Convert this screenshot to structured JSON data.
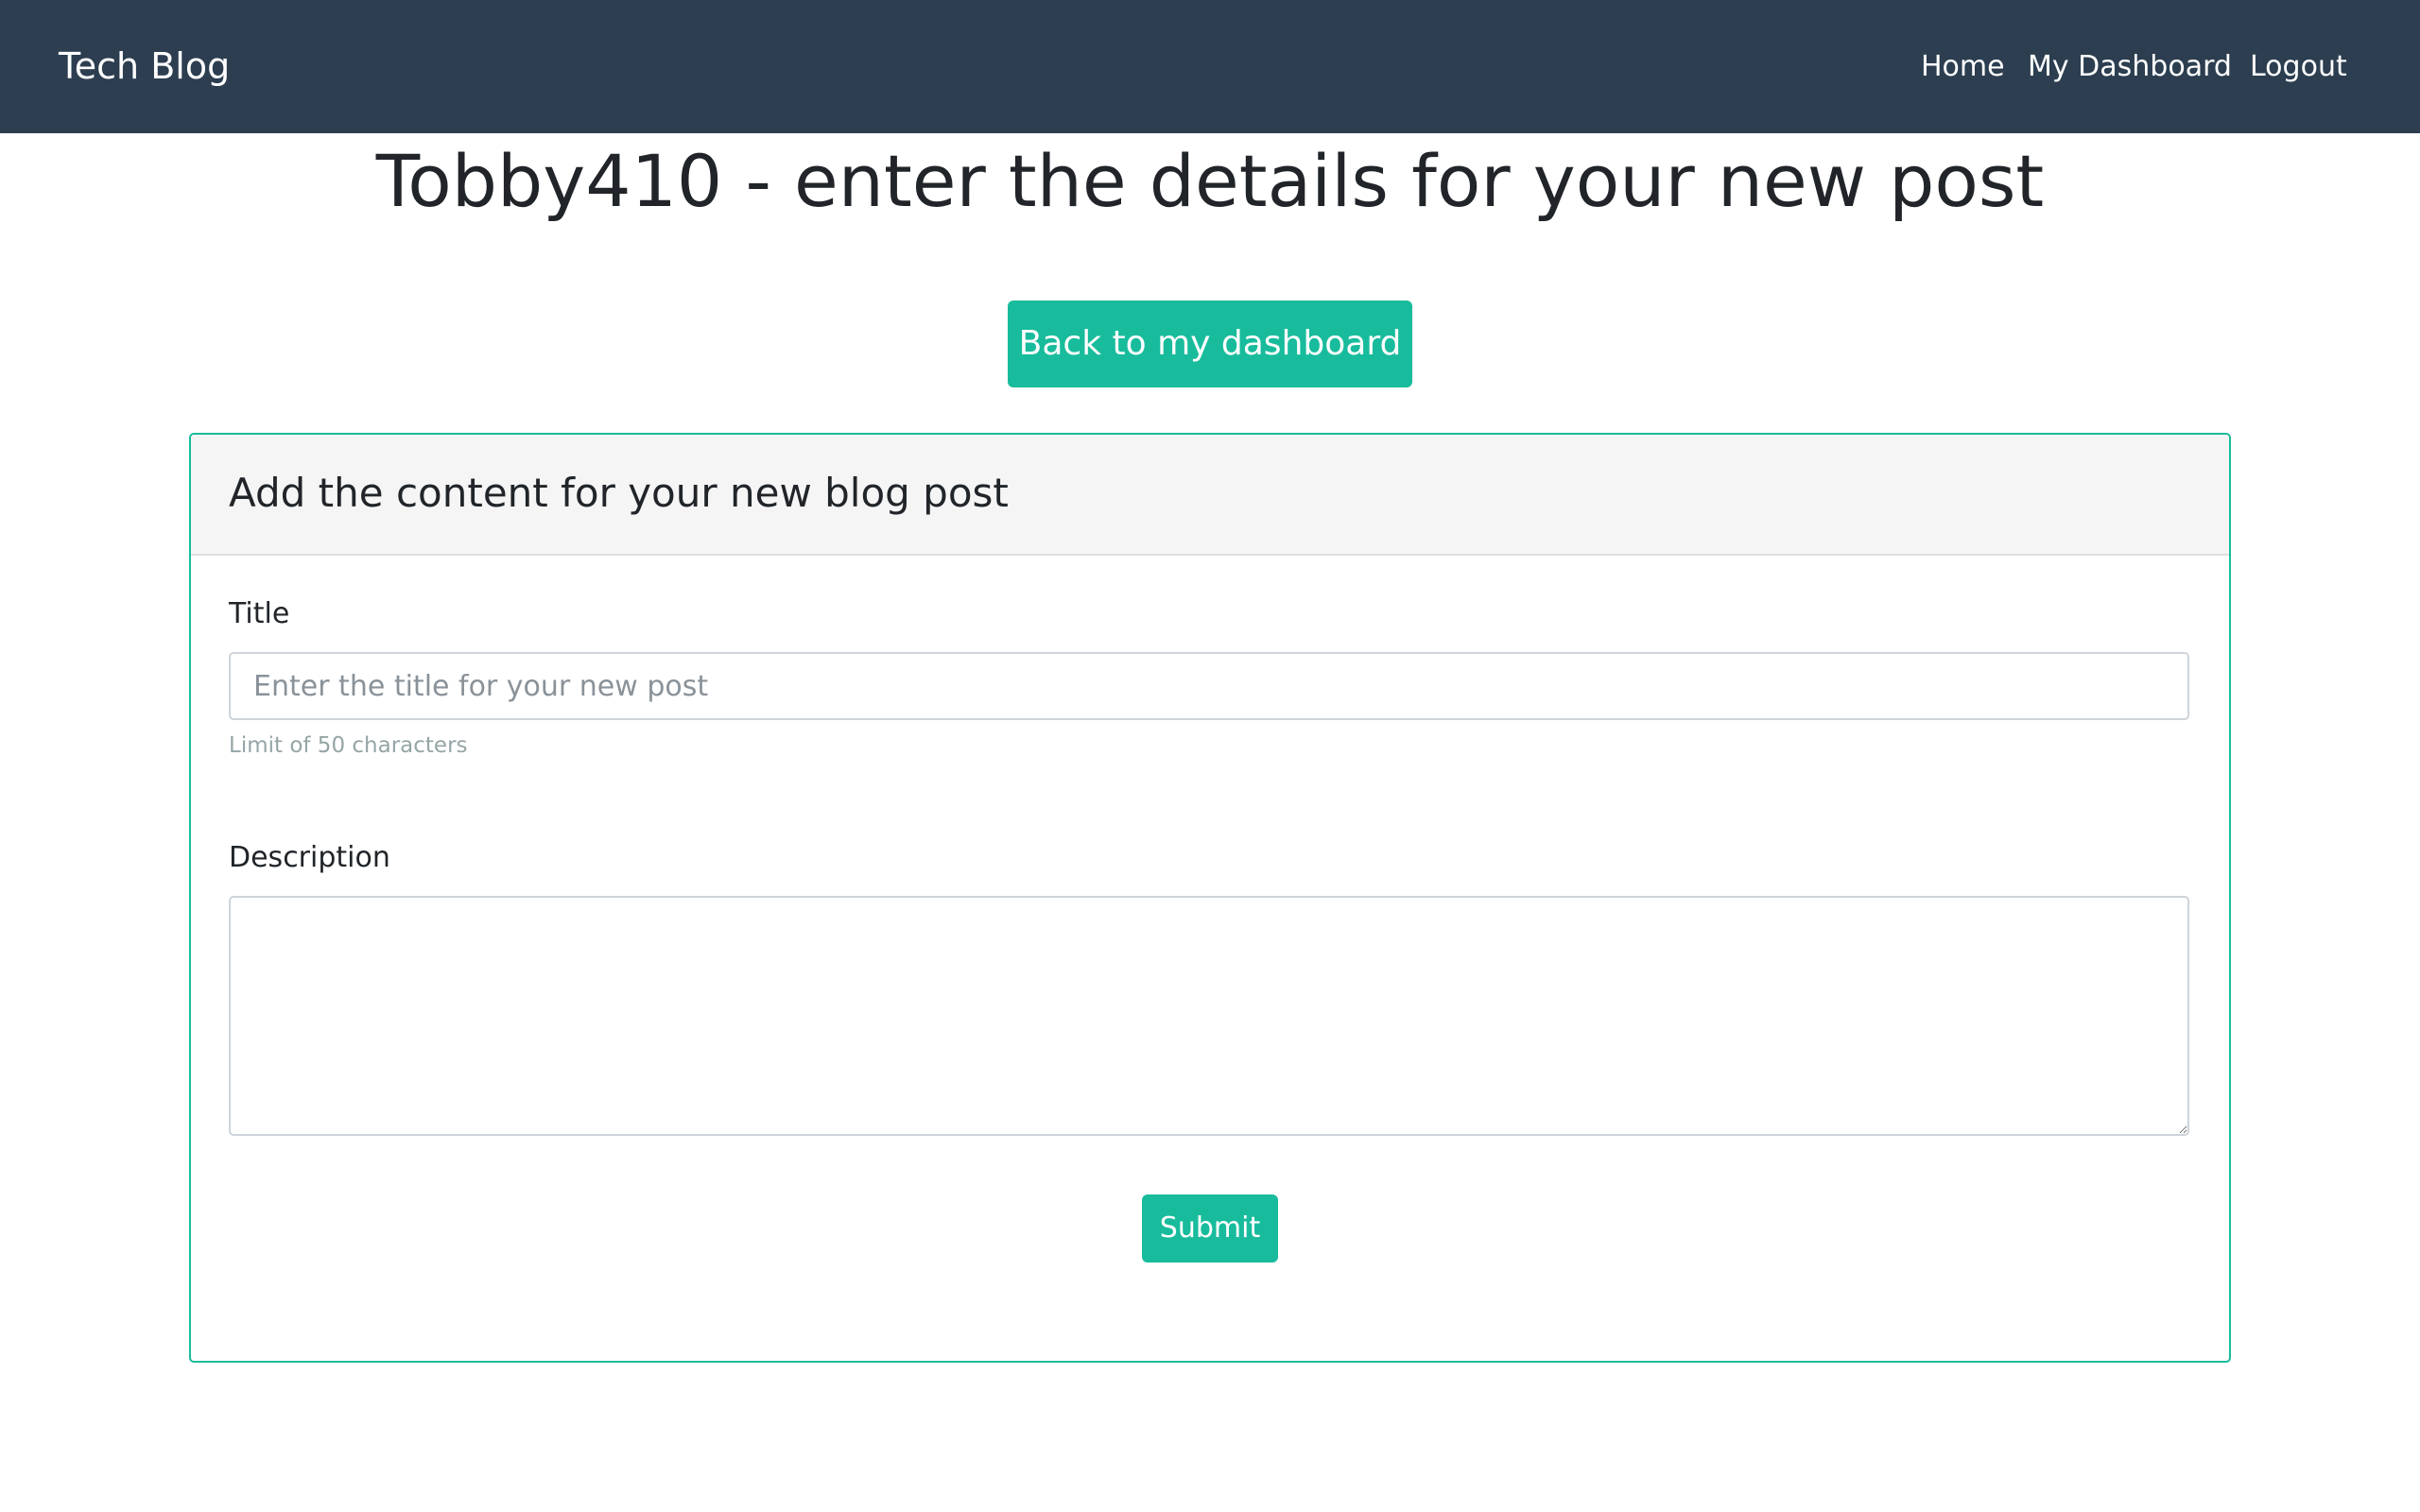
{
  "navbar": {
    "brand": "Tech Blog",
    "links": [
      {
        "label": "Home"
      },
      {
        "label": "My Dashboard"
      },
      {
        "label": "Logout"
      }
    ]
  },
  "page": {
    "title": "Tobby410 - enter the details for your new post",
    "back_button": "Back to my dashboard"
  },
  "form": {
    "header": "Add the content for your new blog post",
    "title_label": "Title",
    "title_value": "",
    "title_placeholder": "Enter the title for your new post",
    "title_help": "Limit of 50 characters",
    "description_label": "Description",
    "description_value": "",
    "submit_label": "Submit"
  },
  "colors": {
    "navbar_bg": "#2c3e50",
    "accent": "#18bc9c",
    "card_header_bg": "#f5f5f5",
    "muted_text": "#95a5a6"
  }
}
